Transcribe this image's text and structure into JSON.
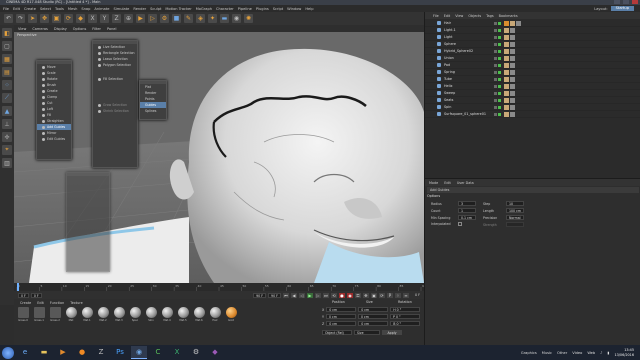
{
  "window": {
    "title": "CINEMA 4D R17.048 Studio (RC) - [Untitled 4 *] - Main"
  },
  "menubar": {
    "items": [
      "File",
      "Edit",
      "Create",
      "Select",
      "Tools",
      "Mesh",
      "Snap",
      "Animate",
      "Simulate",
      "Render",
      "Sculpt",
      "Motion Tracker",
      "MoGraph",
      "Character",
      "Pipeline",
      "Plugins",
      "Script",
      "Window",
      "Help"
    ],
    "layout_label": "Layout:",
    "layout_value": "Startup"
  },
  "viewport": {
    "menu": [
      "View",
      "Cameras",
      "Display",
      "Options",
      "Filter",
      "Panel"
    ],
    "label": "Perspective"
  },
  "palettes": {
    "sculpt_tools": [
      "Move",
      "Scale",
      "Rotate",
      "Brush",
      "Create",
      "Clamp",
      "Cut",
      "Loft",
      "Fill",
      "Straighten",
      "Add Guides",
      "Mirror",
      "Edit Guides"
    ],
    "sculpt_selected": "Add Guides",
    "selection": [
      "Live Selection",
      "Rectangle Selection",
      "Lasso Selection",
      "Polygon Selection",
      "Fill Selection",
      "Grow Selection",
      "Shrink Selection"
    ],
    "modes": [
      "Plat",
      "Render",
      "Points",
      "Guides",
      "Splines"
    ],
    "modes_selected": "Guides"
  },
  "timeline": {
    "start": "0 F",
    "current": "0 F",
    "end": "90 F",
    "end2": "90 F",
    "frame_readout": "0 F",
    "ticks": [
      "0",
      "5",
      "10",
      "15",
      "20",
      "25",
      "30",
      "35",
      "40",
      "45",
      "50",
      "55",
      "60",
      "65",
      "70",
      "75",
      "80",
      "85",
      "90"
    ]
  },
  "materials": {
    "menu": [
      "Create",
      "Edit",
      "Function",
      "Texture"
    ],
    "items": [
      {
        "name": "Grass.0",
        "kind": "tex"
      },
      {
        "name": "Grass.1",
        "kind": "tex"
      },
      {
        "name": "Grass.2",
        "kind": "tex"
      },
      {
        "name": "Mat",
        "kind": "ball"
      },
      {
        "name": "Mat.1",
        "kind": "ball"
      },
      {
        "name": "Mat.2",
        "kind": "ball"
      },
      {
        "name": "Mat.3",
        "kind": "ball"
      },
      {
        "name": "Spec",
        "kind": "ball"
      },
      {
        "name": "Skin",
        "kind": "ball"
      },
      {
        "name": "Mat.4",
        "kind": "ball"
      },
      {
        "name": "Mat.5",
        "kind": "ball"
      },
      {
        "name": "Mat.6",
        "kind": "ball"
      },
      {
        "name": "Hair",
        "kind": "ball"
      },
      {
        "name": "Gold",
        "kind": "orange"
      }
    ]
  },
  "coordinates": {
    "headers": [
      "Position",
      "Size",
      "Rotation"
    ],
    "rows": [
      {
        "axis": "X",
        "pos": "0 cm",
        "size": "0 cm",
        "rot": "H 0 °"
      },
      {
        "axis": "Y",
        "pos": "0 cm",
        "size": "0 cm",
        "rot": "P 0 °"
      },
      {
        "axis": "Z",
        "pos": "0 cm",
        "size": "0 cm",
        "rot": "B 0 °"
      }
    ],
    "mode": "Object (Rel)",
    "size_mode": "Size",
    "apply": "Apply"
  },
  "objects": {
    "menu": [
      "File",
      "Edit",
      "View",
      "Objects",
      "Tags",
      "Bookmarks"
    ],
    "rows": [
      "Hair",
      "Light.1",
      "Light",
      "Sphere",
      "Hybrid_Sphere02",
      "Union",
      "Pad",
      "Spring",
      "Tube",
      "Helix",
      "Sweep",
      "Seats",
      "Spin",
      "Surfsquare_01_sphere01"
    ]
  },
  "attributes": {
    "menu": [
      "Mode",
      "Edit",
      "User Data"
    ],
    "title": "Add Guides",
    "tab": "Options",
    "fields": [
      {
        "label": "Radius",
        "value": "3"
      },
      {
        "label": "Count",
        "value": "1"
      },
      {
        "label": "Min Spacing",
        "value": "0.1 cm"
      },
      {
        "label": "Interpolated",
        "value": ""
      }
    ],
    "fields_right": [
      {
        "label": "Step",
        "value": "10"
      },
      {
        "label": "Length",
        "value": "100 cm"
      },
      {
        "label": "Precision",
        "value": "Normal"
      },
      {
        "label": "Strength",
        "value": ""
      }
    ]
  },
  "taskbar": {
    "tray_items": [
      "Graphics",
      "Music",
      "Other",
      "Video",
      "Web"
    ],
    "time": "13:45",
    "date": "13/06/2016"
  },
  "colors": {
    "accent": "#5a7fa8",
    "title_bar": "#3a3f48",
    "taskbar": "#1c2330"
  }
}
